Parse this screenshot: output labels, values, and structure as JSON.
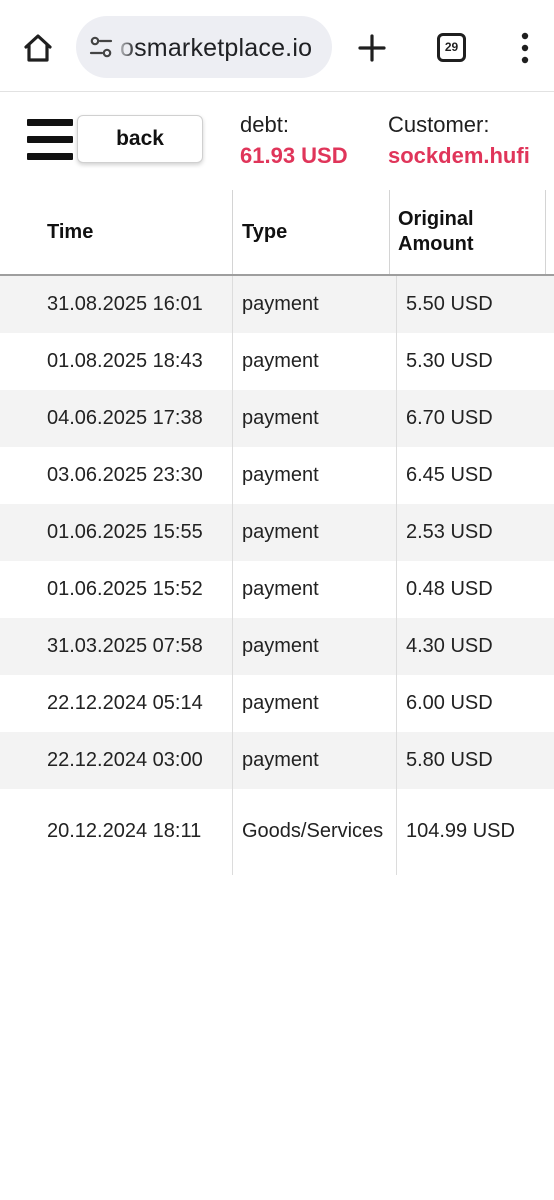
{
  "browser": {
    "url": "osmarketplace.io",
    "tab_count": "29"
  },
  "header": {
    "back_label": "back",
    "debt_label": "debt:",
    "debt_value": "61.93 USD",
    "customer_label": "Customer:",
    "customer_value": "sockdem.hufi"
  },
  "colors": {
    "accent": "#e0355a",
    "row_stripe": "#f3f3f3"
  },
  "table": {
    "columns": [
      "Time",
      "Type",
      "Original",
      "Amount"
    ],
    "rows": [
      {
        "time": "31.08.2025 16:01",
        "type": "payment",
        "amount": "5.50 USD"
      },
      {
        "time": "01.08.2025 18:43",
        "type": "payment",
        "amount": "5.30 USD"
      },
      {
        "time": "04.06.2025 17:38",
        "type": "payment",
        "amount": "6.70 USD"
      },
      {
        "time": "03.06.2025 23:30",
        "type": "payment",
        "amount": "6.45 USD"
      },
      {
        "time": "01.06.2025 15:55",
        "type": "payment",
        "amount": "2.53 USD"
      },
      {
        "time": "01.06.2025 15:52",
        "type": "payment",
        "amount": "0.48 USD"
      },
      {
        "time": "31.03.2025 07:58",
        "type": "payment",
        "amount": "4.30 USD"
      },
      {
        "time": "22.12.2024 05:14",
        "type": "payment",
        "amount": "6.00 USD"
      },
      {
        "time": "22.12.2024 03:00",
        "type": "payment",
        "amount": "5.80 USD"
      },
      {
        "time": "20.12.2024 18:11",
        "type": "Goods/Services",
        "amount": "104.99 USD"
      }
    ]
  },
  "icons": {
    "home": "home-icon",
    "site_settings": "tune-icon",
    "new_tab": "plus-icon",
    "tabs": "tab-switcher-icon",
    "menu": "more-vert-icon",
    "nav_menu": "hamburger-icon"
  }
}
